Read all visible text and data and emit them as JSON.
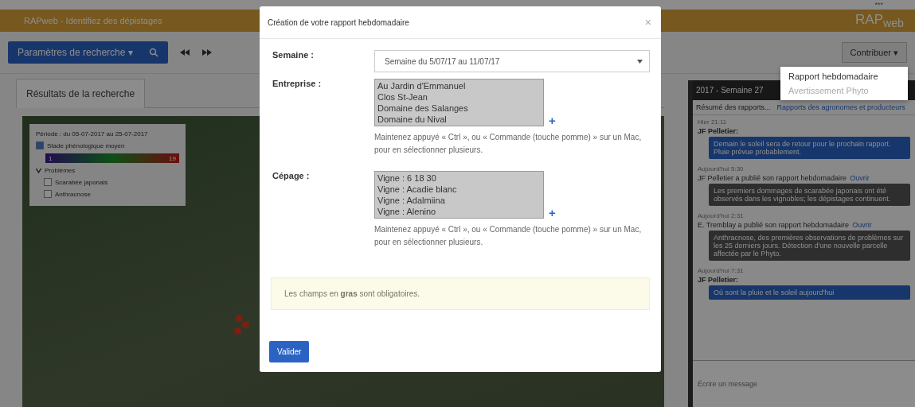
{
  "header": {
    "app_title": "RAPweb - Identifiez des dépistages",
    "logo": "RAP",
    "logo_sub": "web",
    "corner_mark": "***"
  },
  "toolbar": {
    "search_button": "Paramètres de recherche ▾",
    "contribute_button": "Contribuer ▾"
  },
  "contribute_menu": {
    "open": true,
    "items": [
      {
        "label": "Rapport hebdomadaire",
        "disabled": false
      },
      {
        "label": "Avertissement Phyto",
        "disabled": true
      }
    ]
  },
  "tabs": [
    {
      "label": "Résultats de la recherche",
      "selected": true
    }
  ],
  "legend": {
    "period": "Période : du 05-07-2017 au 25-07-2017",
    "layers": [
      {
        "label": "Stade phénologique moyen",
        "checked": true
      }
    ],
    "scale_min": "1",
    "scale_max": "19",
    "group": {
      "label": "Problèmes",
      "expanded": true,
      "items": [
        {
          "label": "Scarabée japonais",
          "checked": false
        },
        {
          "label": "Anthracnose",
          "checked": false
        }
      ]
    }
  },
  "side_panel": {
    "title": "2017 - Semaine 27",
    "tabs": [
      {
        "label": "Résumé des rapports...",
        "selected": true
      },
      {
        "label": "Rapports des agronomes et producteurs",
        "selected": false
      }
    ],
    "messages": [
      {
        "kind": "chat",
        "time": "Hier 21:11",
        "author": "JF Pelletier:",
        "text": "Demain le soleil sera de retour pour le prochain rapport. Pluie prévue probablement."
      },
      {
        "kind": "report",
        "time": "Aujourd'hui 5:30",
        "author": "JF Pelletier a publié son rapport hebdomadaire",
        "link": "Ouvrir",
        "text": "Les premiers dommages de scarabée japonais ont été observés dans les vignobles; les dépistages continuent."
      },
      {
        "kind": "report",
        "time": "Aujourd'hui 2:31",
        "author": "E. Tremblay a publié son rapport hebdomadaire",
        "link": "Ouvrir",
        "text": "Anthracnose, des premières observations de problèmes sur les 25 derniers jours. Détection d'une nouvelle parcelle affectée par le Phyto."
      },
      {
        "kind": "chat",
        "time": "Aujourd'hui 7:31",
        "author": "JF Pelletier:",
        "text": "Où sont la pluie et le soleil aujourd'hui"
      }
    ],
    "input_placeholder": "Écrire un message"
  },
  "modal": {
    "title": "Création de votre rapport hebdomadaire",
    "close": "×",
    "fields": [
      {
        "kind": "select",
        "label": "Semaine :",
        "value": "Semaine du 5/07/17 au 11/07/17"
      },
      {
        "kind": "multi",
        "label": "Entreprise :",
        "options": [
          "Au Jardin d'Emmanuel",
          "Clos St-Jean",
          "Domaine des Salanges",
          "Domaine du Nival"
        ],
        "add": "+",
        "help": "Maintenez appuyé « Ctrl », ou « Commande (touche pomme) » sur un Mac, pour en sélectionner plusieurs."
      },
      {
        "kind": "multi",
        "label": "Cépage :",
        "options": [
          "Vigne : 6 18 30",
          "Vigne : Acadie blanc",
          "Vigne : Adalmiina",
          "Vigne : Alenino"
        ],
        "add": "+",
        "help": "Maintenez appuyé « Ctrl », ou « Commande (touche pomme) » sur un Mac, pour en sélectionner plusieurs."
      }
    ],
    "notice": "Les champs en **gras** sont obligatoires.",
    "submit": "Valider"
  }
}
